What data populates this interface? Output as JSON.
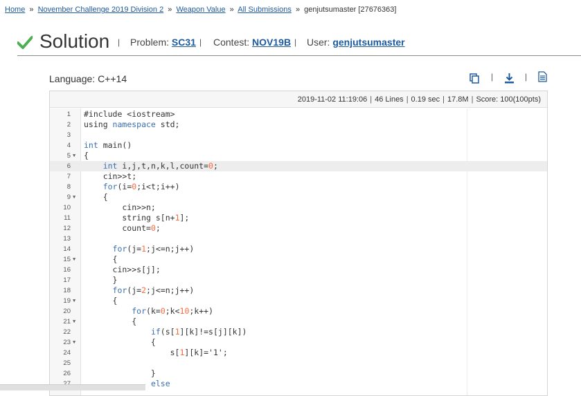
{
  "breadcrumb": {
    "items": [
      "Home",
      "November Challenge 2019 Division 2",
      "Weapon Value",
      "All Submissions"
    ],
    "current": "genjutsumaster [27676363]",
    "separator": "»"
  },
  "header": {
    "title": "Solution",
    "problem_label": "Problem:",
    "problem_value": "SC31",
    "contest_label": "Contest:",
    "contest_value": "NOV19B",
    "user_label": "User:",
    "user_value": "genjutsumaster",
    "bar": "|"
  },
  "language": "Language: C++14",
  "stats": {
    "date": "2019-11-02 11:19:06",
    "lines": "46 Lines",
    "time": "0.19 sec",
    "memory": "17.8M",
    "score": "Score: 100(100pts)",
    "separator": "|"
  },
  "colors": {
    "accent_green": "#4caf50",
    "link": "#1d5aa0",
    "keyword": "#3b6fb0",
    "number": "#ff6a3d"
  },
  "icons": [
    "check-icon",
    "copy-icon",
    "download-icon",
    "document-icon"
  ],
  "code": {
    "active_line": 6,
    "lines": [
      {
        "n": "1",
        "fold": false,
        "html": "#include &lt;iostream&gt;"
      },
      {
        "n": "2",
        "fold": false,
        "html": "using <span class='kw'>namespace</span> std;"
      },
      {
        "n": "3",
        "fold": false,
        "html": ""
      },
      {
        "n": "4",
        "fold": false,
        "html": "<span class='kw'>int</span> main()"
      },
      {
        "n": "5",
        "fold": true,
        "html": "{"
      },
      {
        "n": "6",
        "fold": false,
        "html": "    <span class='kw'>int</span> i,j,t,n,k,l,count=<span class='num'>0</span>;"
      },
      {
        "n": "7",
        "fold": false,
        "html": "    cin&gt;&gt;t;"
      },
      {
        "n": "8",
        "fold": false,
        "html": "    <span class='kw'>for</span>(i=<span class='num'>0</span>;i&lt;t;i++)"
      },
      {
        "n": "9",
        "fold": true,
        "html": "    {"
      },
      {
        "n": "10",
        "fold": false,
        "html": "        cin&gt;&gt;n;"
      },
      {
        "n": "11",
        "fold": false,
        "html": "        string s[n+<span class='num'>1</span>];"
      },
      {
        "n": "12",
        "fold": false,
        "html": "        count=<span class='num'>0</span>;"
      },
      {
        "n": "13",
        "fold": false,
        "html": ""
      },
      {
        "n": "14",
        "fold": false,
        "html": "      <span class='kw'>for</span>(j=<span class='num'>1</span>;j&lt;=n;j++)"
      },
      {
        "n": "15",
        "fold": true,
        "html": "      {"
      },
      {
        "n": "16",
        "fold": false,
        "html": "      cin&gt;&gt;s[j];"
      },
      {
        "n": "17",
        "fold": false,
        "html": "      }"
      },
      {
        "n": "18",
        "fold": false,
        "html": "      <span class='kw'>for</span>(j=<span class='num'>2</span>;j&lt;=n;j++)"
      },
      {
        "n": "19",
        "fold": true,
        "html": "      {"
      },
      {
        "n": "20",
        "fold": false,
        "html": "          <span class='kw'>for</span>(k=<span class='num'>0</span>;k&lt;<span class='num'>10</span>;k++)"
      },
      {
        "n": "21",
        "fold": true,
        "html": "          {"
      },
      {
        "n": "22",
        "fold": false,
        "html": "              <span class='kw'>if</span>(s[<span class='num'>1</span>][k]!=s[j][k])"
      },
      {
        "n": "23",
        "fold": true,
        "html": "              {"
      },
      {
        "n": "24",
        "fold": false,
        "html": "                  s[<span class='num'>1</span>][k]=<span class='str'>'1'</span>;"
      },
      {
        "n": "25",
        "fold": false,
        "html": ""
      },
      {
        "n": "26",
        "fold": false,
        "html": "              }"
      },
      {
        "n": "27",
        "fold": false,
        "html": "              <span class='kw'>else</span>"
      }
    ]
  }
}
